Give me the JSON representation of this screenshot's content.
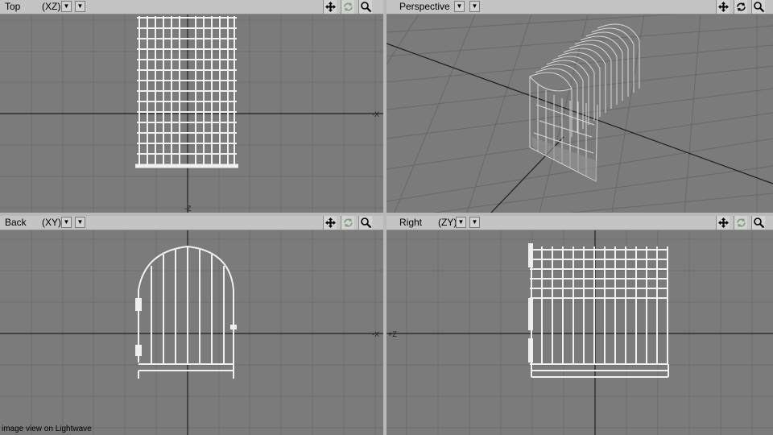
{
  "viewports": {
    "top": {
      "title": "Top",
      "axis": "(XZ)"
    },
    "perspective": {
      "title": "Perspective"
    },
    "back": {
      "title": "Back",
      "axis": "(XY)"
    },
    "right": {
      "title": "Right",
      "axis": "(ZY)"
    }
  },
  "tool_icons": [
    "move-view-icon",
    "rotate-view-icon",
    "zoom-view-icon"
  ],
  "caption": "image view on Lightwave",
  "colors": {
    "viewport_bg": "#7b7b7b",
    "grid": "#6d6d6d",
    "axis": "#202020",
    "mesh": "#f0f0f0",
    "header_bg": "#c4c4c4"
  }
}
